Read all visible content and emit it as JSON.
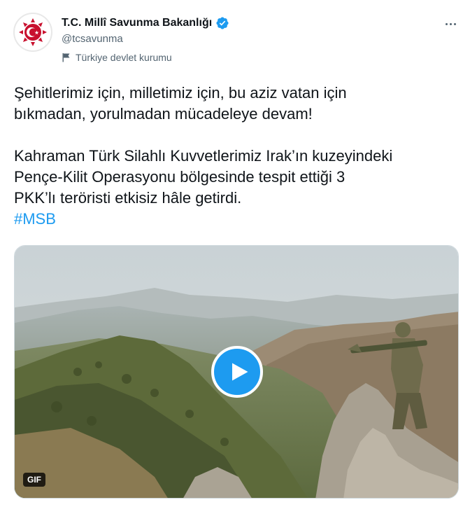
{
  "account": {
    "display_name": "T.C. Millî Savunma Bakanlığı",
    "handle": "@tcsavunma",
    "label": "Türkiye devlet kurumu",
    "verified": true,
    "avatar_icon": "ministry-emblem-icon",
    "accent_color": "#c8102e"
  },
  "tweet": {
    "paragraph1_line1": "Şehitlerimiz için, milletimiz için, bu aziz vatan için",
    "paragraph1_line2": "bıkmadan, yorulmadan mücadeleye devam!",
    "paragraph2_line1": "Kahraman Türk Silahlı Kuvvetlerimiz Irak’ın kuzeyindeki",
    "paragraph2_line2": "Pençe-Kilit Operasyonu bölgesinde tespit ettiği 3",
    "paragraph2_line3": "PKK’lı teröristi etkisiz hâle getirdi.",
    "hashtag": "#MSB"
  },
  "media": {
    "badge": "GIF",
    "play_icon": "play-icon",
    "play_color": "#1d9bf0"
  },
  "icons": {
    "verified": "verified-badge-icon",
    "more": "more-options-icon",
    "label": "flag-icon"
  }
}
